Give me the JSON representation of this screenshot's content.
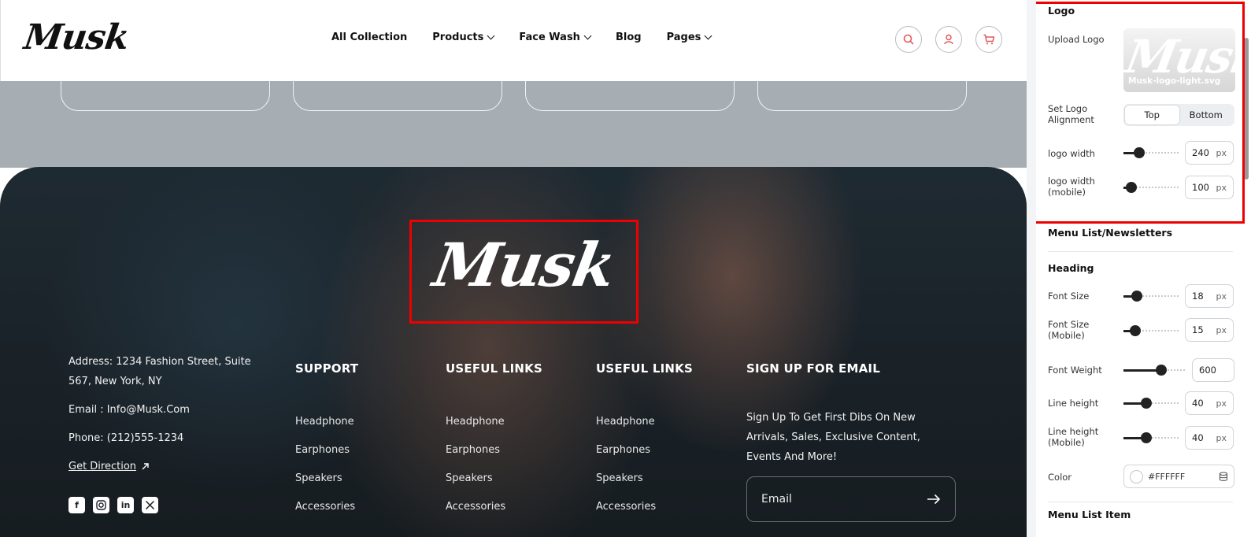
{
  "header": {
    "brand": "Musk",
    "nav": [
      {
        "label": "All Collection",
        "dropdown": false
      },
      {
        "label": "Products",
        "dropdown": true
      },
      {
        "label": "Face Wash",
        "dropdown": true
      },
      {
        "label": "Blog",
        "dropdown": false
      },
      {
        "label": "Pages",
        "dropdown": true
      }
    ],
    "icons": [
      "search-icon",
      "user-icon",
      "cart-icon"
    ],
    "accent_color": "#e35a5a"
  },
  "footer": {
    "logo": "Musk",
    "address": "Address: 1234 Fashion Street, Suite 567, New York, NY",
    "email": "Email : Info@Musk.Com",
    "phone": "Phone: (212)555-1234",
    "direction": "Get Direction",
    "socials": [
      "facebook-icon",
      "instagram-icon",
      "linkedin-icon",
      "x-icon"
    ],
    "columns": [
      {
        "heading": "SUPPORT",
        "links": [
          "Headphone",
          "Earphones",
          "Speakers",
          "Accessories"
        ]
      },
      {
        "heading": "USEFUL LINKS",
        "links": [
          "Headphone",
          "Earphones",
          "Speakers",
          "Accessories"
        ]
      },
      {
        "heading": "USEFUL LINKS",
        "links": [
          "Headphone",
          "Earphones",
          "Speakers",
          "Accessories"
        ]
      }
    ],
    "signup": {
      "heading": "SIGN UP FOR EMAIL",
      "description": "Sign Up To Get First Dibs On New Arrivals, Sales, Exclusive Content, Events And More!",
      "email_placeholder": "Email"
    }
  },
  "panel": {
    "logo_section": "Logo",
    "upload_logo_label": "Upload Logo",
    "upload_filename": "Musk-logo-light.svg",
    "alignment_label": "Set Logo Alignment",
    "alignment_options": [
      "Top",
      "Bottom"
    ],
    "alignment_selected": "Top",
    "logo_width_label": "logo width",
    "logo_width": "240",
    "logo_width_mobile_label": "logo width (mobile)",
    "logo_width_mobile": "100",
    "unit": "px",
    "menu_section": "Menu List/Newsletters",
    "heading_section": "Heading",
    "font_size_label": "Font Size",
    "font_size": "18",
    "font_size_mobile_label": "Font Size (Mobile)",
    "font_size_mobile": "15",
    "font_weight_label": "Font Weight",
    "font_weight": "600",
    "line_height_label": "Line height",
    "line_height": "40",
    "line_height_mobile_label": "Line height (Mobile)",
    "line_height_mobile": "40",
    "color_label": "Color",
    "color_value": "#FFFFFF",
    "menu_list_item_section": "Menu List Item",
    "sliders": {
      "logo_width": 0.28,
      "logo_width_mobile": 0.14,
      "font_size": 0.24,
      "font_size_mobile": 0.21,
      "font_weight": 0.6,
      "line_height": 0.4,
      "line_height_mobile": 0.4
    }
  }
}
